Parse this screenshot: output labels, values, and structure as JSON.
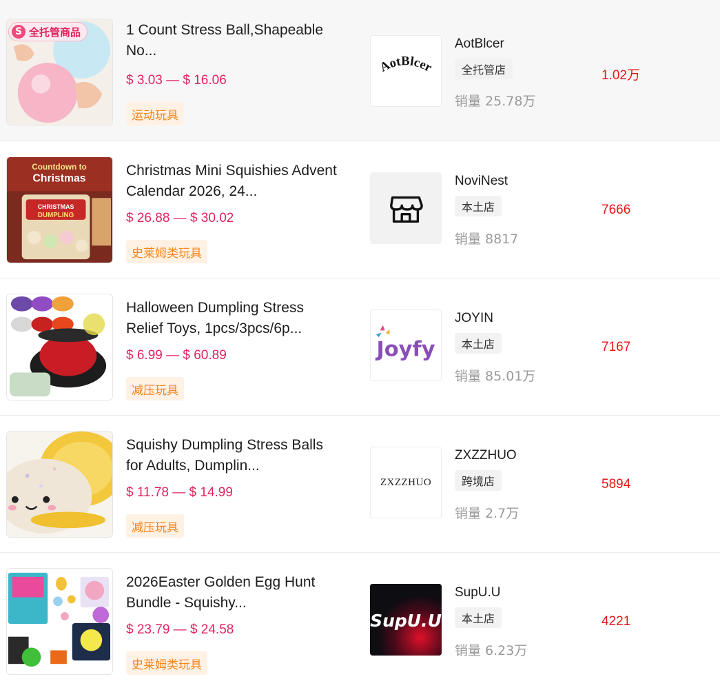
{
  "products": [
    {
      "badge": {
        "icon": "S",
        "text": "全托管商品"
      },
      "title": "1 Count Stress Ball,Shapeable No...",
      "price": "$ 3.03 — $ 16.06",
      "category": "运动玩具",
      "shop_name": "AotBlcer",
      "shop_type": "全托管店",
      "sales": "销量 25.78万",
      "metric": "1.02万",
      "logo_text": "AotBlcer"
    },
    {
      "title": "Christmas Mini Squishies Advent Calendar 2026, 24...",
      "price": "$ 26.88 — $ 30.02",
      "category": "史莱姆类玩具",
      "shop_name": "NoviNest",
      "shop_type": "本土店",
      "sales": "销量 8817",
      "metric": "7666",
      "thumb_text": [
        "Countdown to",
        "Christmas",
        "CHRISTMAS",
        "DUMPLING"
      ]
    },
    {
      "title": "Halloween Dumpling Stress Relief Toys, 1pcs/3pcs/6p...",
      "price": "$ 6.99 — $ 60.89",
      "category": "减压玩具",
      "shop_name": "JOYIN",
      "shop_type": "本土店",
      "sales": "销量 85.01万",
      "metric": "7167",
      "logo_text": "Joyfy"
    },
    {
      "title": "Squishy Dumpling Stress Balls for Adults, Dumplin...",
      "price": "$ 11.78 — $ 14.99",
      "category": "减压玩具",
      "shop_name": "ZXZZHUO",
      "shop_type": "跨境店",
      "sales": "销量 2.7万",
      "metric": "5894",
      "logo_text": "ZXZZHUO"
    },
    {
      "title": "2026Easter Golden Egg Hunt Bundle - Squishy...",
      "price": "$ 23.79 — $ 24.58",
      "category": "史莱姆类玩具",
      "shop_name": "SupU.U",
      "shop_type": "本土店",
      "sales": "销量 6.23万",
      "metric": "4221",
      "logo_text": "SupU.U"
    }
  ],
  "colors": {
    "price": "#e0245e",
    "metric": "#e5161b",
    "tag_bg": "#fff1e4",
    "tag_text": "#f5861f",
    "sales": "#9a9a9a"
  }
}
